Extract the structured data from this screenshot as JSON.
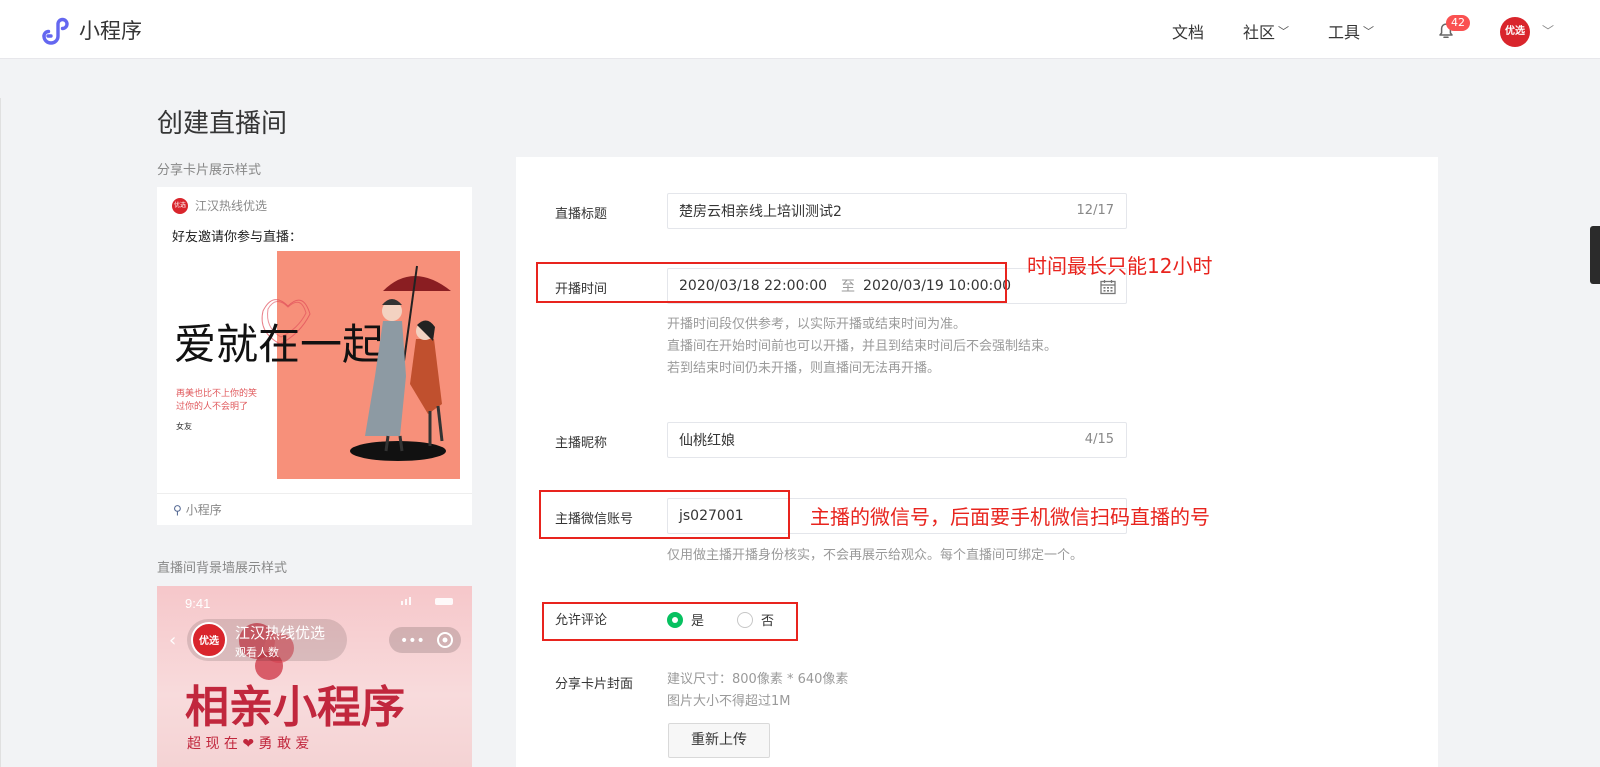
{
  "header": {
    "app_name": "小程序",
    "nav": {
      "docs": "文档",
      "community": "社区",
      "tools": "工具"
    },
    "notification_count": "42",
    "avatar_text": "优选"
  },
  "page": {
    "title": "创建直播间"
  },
  "share_card": {
    "section_label": "分享卡片展示样式",
    "account_name": "江汉热线优选",
    "invite_text": "好友邀请你参与直播：",
    "poster_title": "爱就在一起",
    "poster_caption_1": "再美也比不上你的笑",
    "poster_caption_2": "过你的人不会明了",
    "poster_caption_3": "女友",
    "footer_label": "小程序"
  },
  "background_wall": {
    "section_label": "直播间背景墙展示样式",
    "time": "9:41",
    "account_name": "江汉热线优选",
    "viewers_label": "观看人数",
    "banner_title": "相亲小程序",
    "banner_slogan": "超 现 在 ❤ 勇 敢 爱"
  },
  "form": {
    "title_label": "直播标题",
    "title_value": "楚房云相亲线上培训测试2",
    "title_counter": "12/17",
    "time_label": "开播时间",
    "time_start": "2020/03/18 22:00:00",
    "time_sep": "至",
    "time_end": "2020/03/19 10:00:00",
    "time_hint_1": "开播时间段仅供参考，以实际开播或结束时间为准。",
    "time_hint_2": "直播间在开始时间前也可以开播，并且到结束时间后不会强制结束。",
    "time_hint_3": "若到结束时间仍未开播，则直播间无法再开播。",
    "nickname_label": "主播昵称",
    "nickname_value": "仙桃红娘",
    "nickname_counter": "4/15",
    "wechat_label": "主播微信账号",
    "wechat_value": "js027001",
    "wechat_hint": "仅用做主播开播身份核实，不会再展示给观众。每个直播间可绑定一个。",
    "comment_label": "允许评论",
    "comment_yes": "是",
    "comment_no": "否",
    "comment_selected": "是",
    "cover_label": "分享卡片封面",
    "cover_hint_1": "建议尺寸：800像素 * 640像素",
    "cover_hint_2": "图片大小不得超过1M",
    "reupload_label": "重新上传"
  },
  "annotations": {
    "time_note": "时间最长只能12小时",
    "wechat_note": "主播的微信号，后面要手机微信扫码直播的号",
    "color": "#e8241e"
  }
}
